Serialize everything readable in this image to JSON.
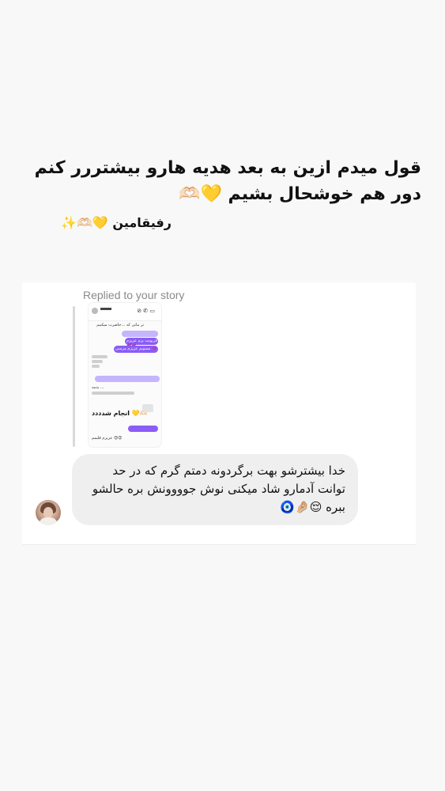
{
  "story_caption": {
    "line": "قول میدم ازین به بعد هدیه هارو بیشتررر کنم دور هم خوشحال بشیم 💛🫶🏻",
    "sub": "رفیقامین 💛🫶🏻✨"
  },
  "reply_card": {
    "replied_label": "Replied to your story",
    "thumbnail": {
      "top_text": "تر ماتی که ...حاضرت میکنیم",
      "purple_text_1": "قربونت برم عزیزم 💜💜",
      "purple_text_2": "ممنونم عزیزم مرسی 💜",
      "grey_text": "بدمه ...",
      "bold_text": "انجام شدددد 💛🫶🏻",
      "bottom_text": "عزیزم قلبمم 😍😍"
    },
    "message": "خدا بیشترشو بهت برگردونه دمتم گرم که در حد توانت آدمارو شاد میکنی نوش جوووونش بره حالشو ببره 😌🤌🏼🧿"
  },
  "colors": {
    "background": "#f8f8f8",
    "card": "#ffffff",
    "bubble": "#efefef",
    "accent_purple": "#8b5cf6"
  }
}
